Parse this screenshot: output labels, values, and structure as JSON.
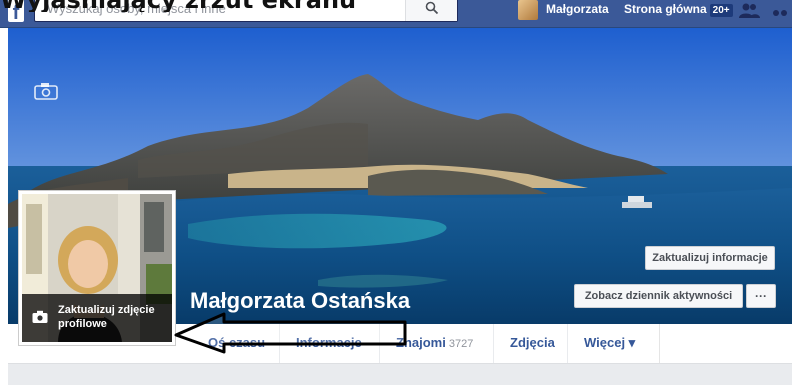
{
  "page_heading": "Wyjaśniający zrzut ekranu",
  "topbar": {
    "logo": "f",
    "search_placeholder": "Wyszukaj osoby, miejsca i inne",
    "user_name": "Małgorzata",
    "home_label": "Strona główna",
    "home_badge": "20+",
    "icons": [
      "search-icon",
      "friend-requests-icon",
      "more-icon"
    ],
    "brand_color": "#3b5998"
  },
  "profile": {
    "name": "Małgorzata Ostańska",
    "update_photo_label": "Zaktualizuj zdjęcie profilowe"
  },
  "cover": {
    "update_info_label": "Zaktualizuj informacje",
    "activity_log_label": "Zobacz dziennik aktywności",
    "more_label": "···"
  },
  "tabs": [
    {
      "label": "Oś czasu"
    },
    {
      "label": "Informacje"
    },
    {
      "label": "Znajomi",
      "count": "3727"
    },
    {
      "label": "Zdjęcia"
    },
    {
      "label": "Więcej ▾"
    }
  ]
}
